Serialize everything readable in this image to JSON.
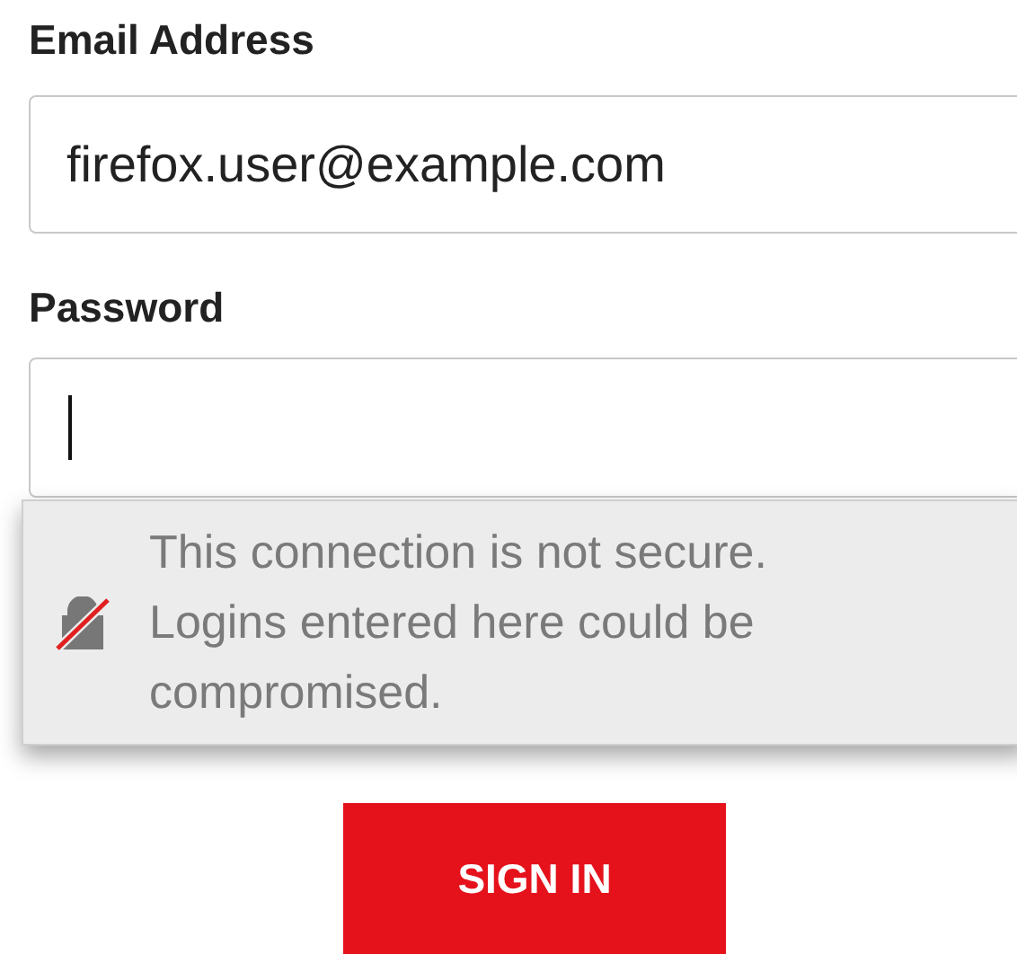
{
  "email": {
    "label": "Email Address",
    "value": "firefox.user@example.com"
  },
  "password": {
    "label": "Password",
    "focused": true
  },
  "warning": {
    "title": "This connection is not secure.",
    "message": "Logins entered here could be compromised."
  },
  "button": {
    "label": "SIGN IN"
  }
}
